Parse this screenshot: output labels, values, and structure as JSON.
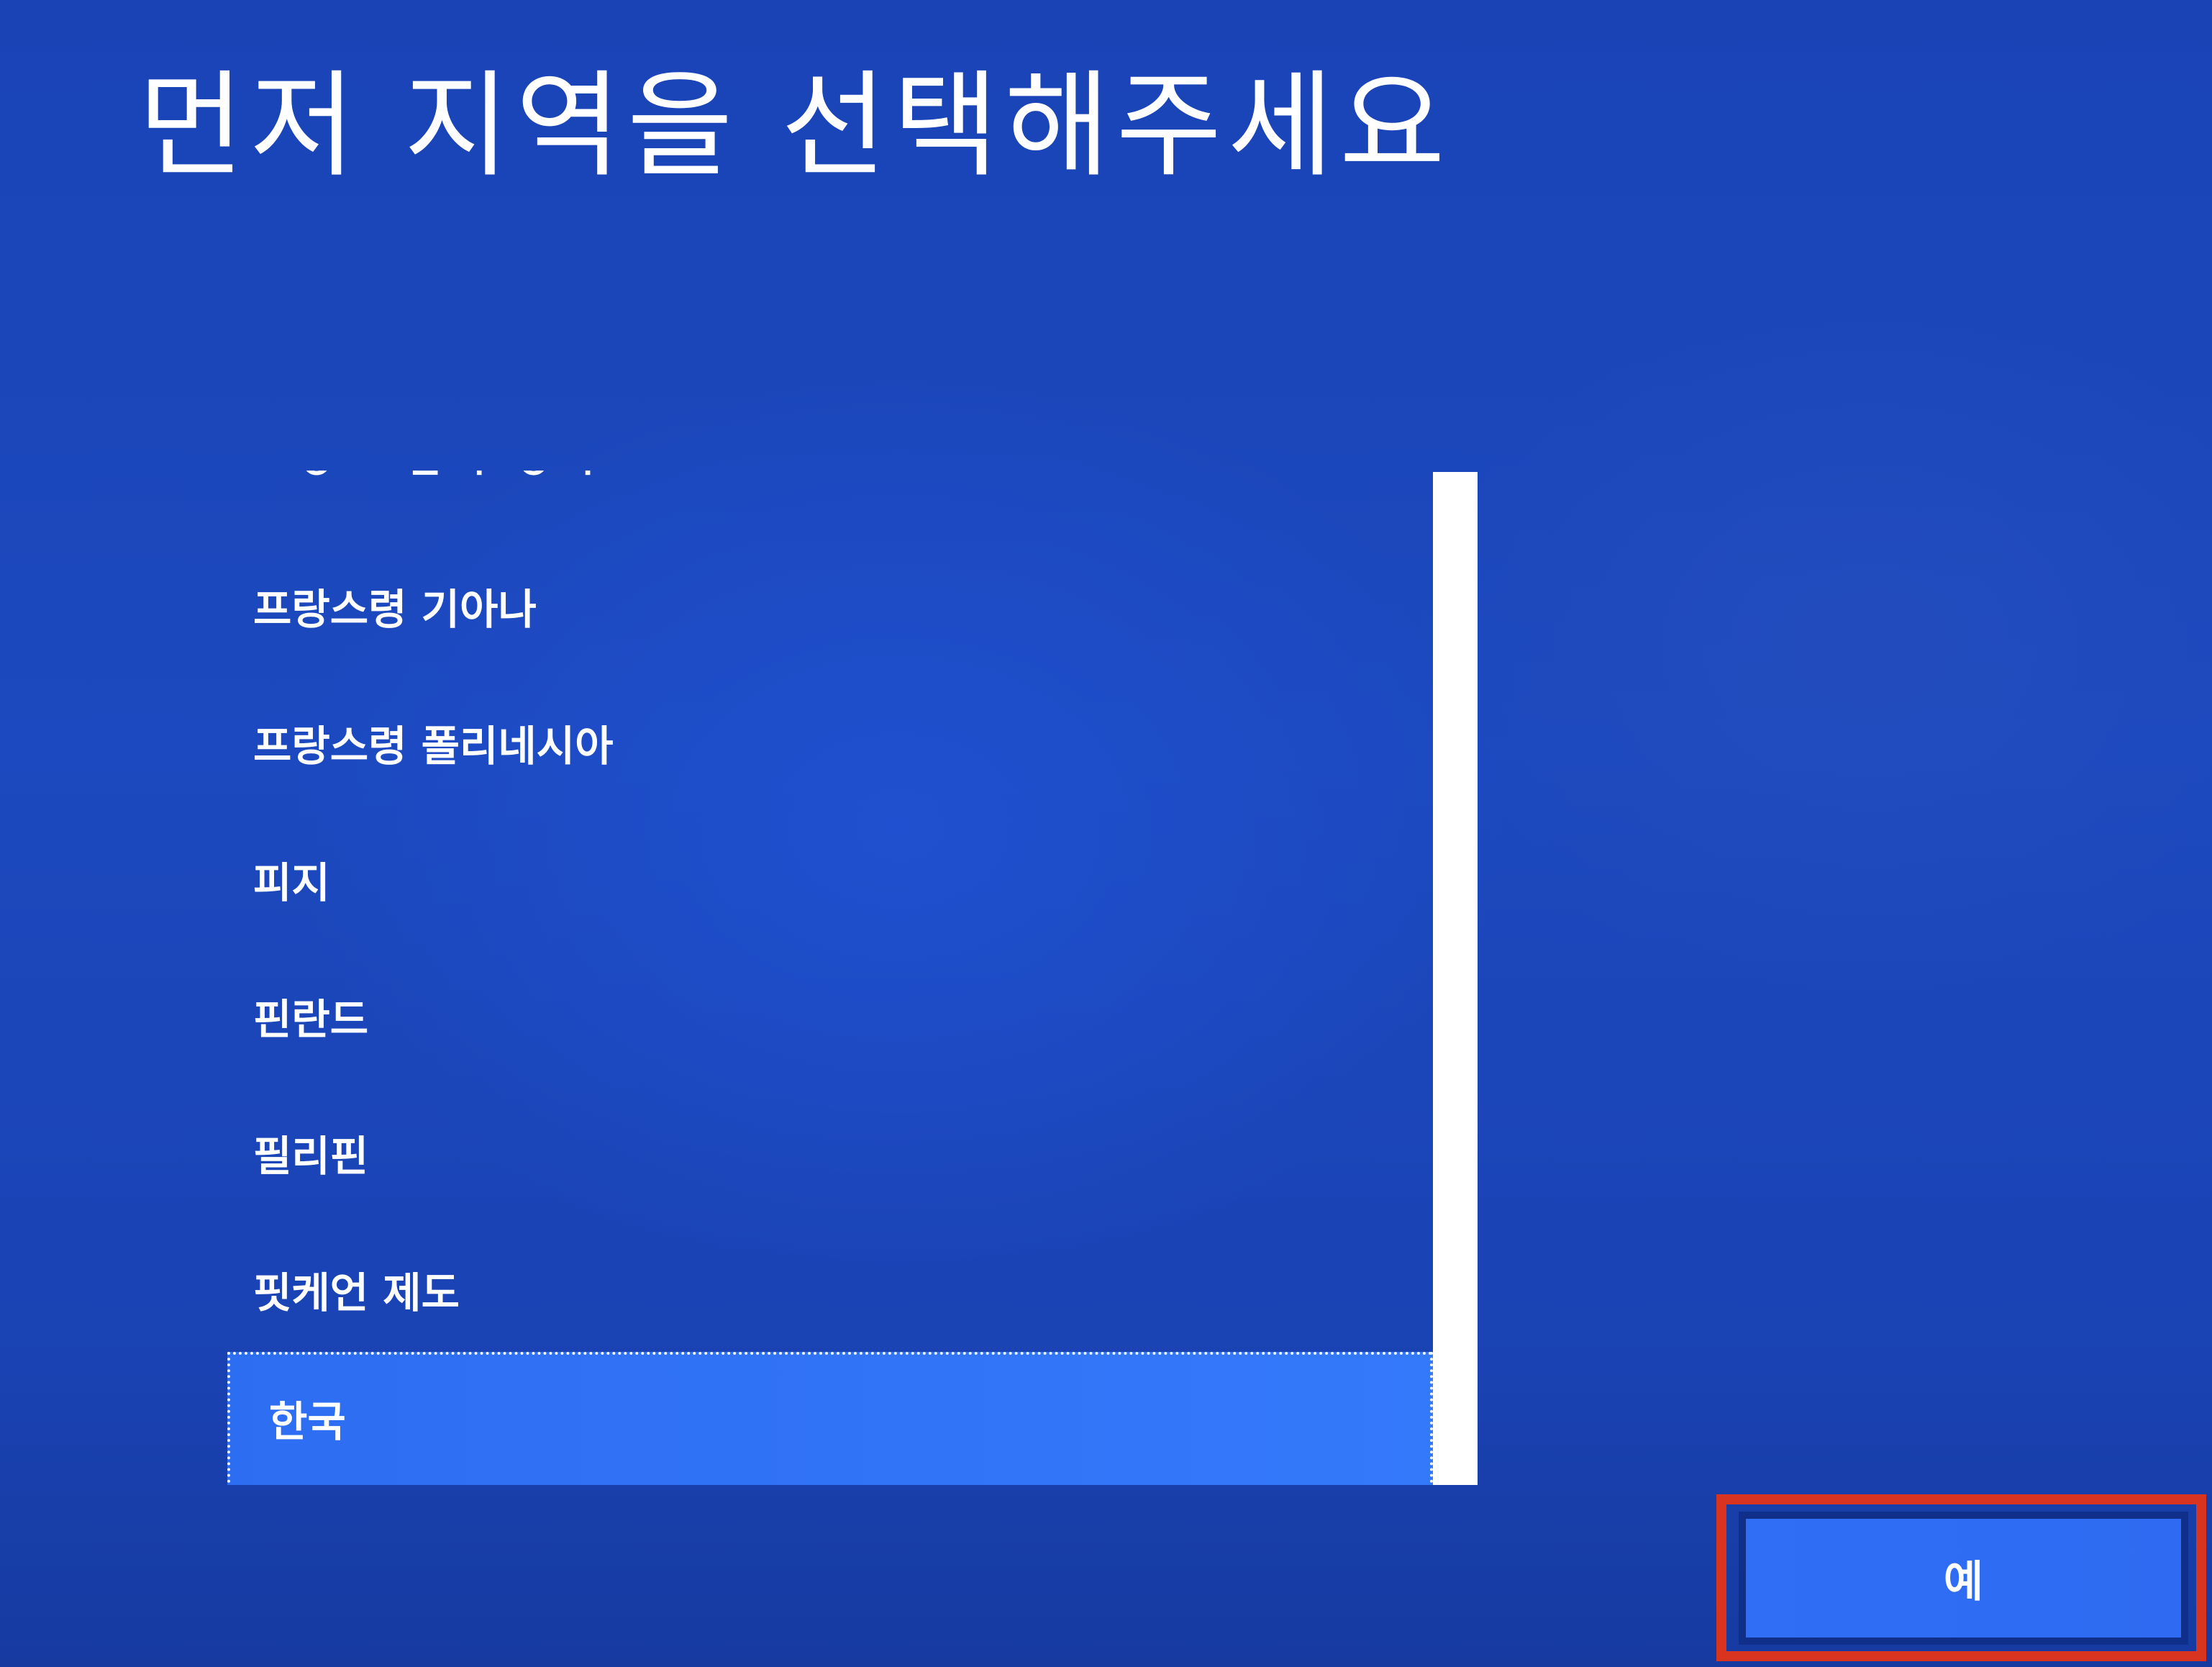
{
  "page": {
    "title": "먼저 지역을 선택해주세요"
  },
  "region_list": {
    "partial_item": "ㅡㅇㅡ ㅁㄱ ㅇㄱ",
    "items": [
      "프랑스령 기아나",
      "프랑스령 폴리네시아",
      "피지",
      "핀란드",
      "필리핀",
      "핏케언 제도"
    ],
    "selected": "한국"
  },
  "actions": {
    "yes_label": "예"
  },
  "colors": {
    "background": "#1c49bf",
    "selected_item": "#3072f7",
    "button": "#2f6ef5",
    "highlight_box": "#d9341f"
  }
}
